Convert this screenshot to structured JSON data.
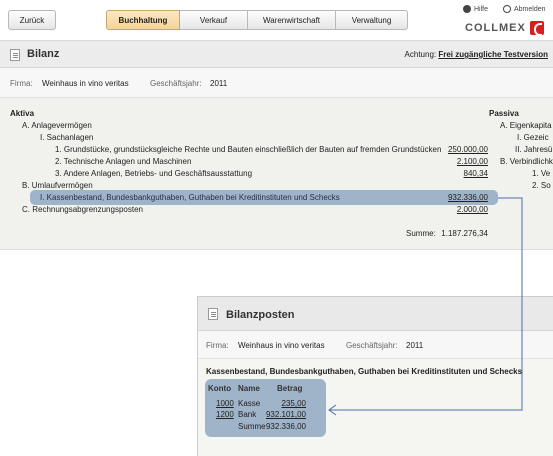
{
  "nav": {
    "back_label": "Zurück",
    "tabs": [
      {
        "label": "Buchhaltung",
        "active": true
      },
      {
        "label": "Verkauf",
        "active": false
      },
      {
        "label": "Warenwirtschaft",
        "active": false
      },
      {
        "label": "Verwaltung",
        "active": false
      }
    ],
    "help_label": "Hilfe",
    "logout_label": "Abmelden",
    "logo_text": "COLLMEX",
    "logo_color": "#d62020"
  },
  "page": {
    "title": "Bilanz",
    "warning_prefix": "Achtung:",
    "warning_link": "Frei zugängliche Testversion"
  },
  "firm": {
    "firm_label": "Firma:",
    "firm_value": "Weinhaus in vino veritas",
    "year_label": "Geschäftsjahr:",
    "year_value": "2011"
  },
  "balance": {
    "aktiva_heading": "Aktiva",
    "passiva_heading": "Passiva",
    "rows": {
      "a": "A.  Anlagevermögen",
      "a1": "I.  Sachanlagen",
      "a1_1": "1.  Grundstücke, grundstücksgleiche Rechte und Bauten einschließlich der Bauten auf fremden Grundstücken",
      "a1_2": "2.  Technische Anlagen und Maschinen",
      "a1_3": "3.  Andere Anlagen, Betriebs- und Geschäftsausstattung",
      "b": "B.  Umlaufvermögen",
      "b1": "I.  Kassenbestand, Bundesbankguthaben, Guthaben bei Kreditinstituten und Schecks",
      "c": "C.  Rechnungsabgrenzungsposten"
    },
    "amounts": {
      "a1_1": "250.000,00",
      "a1_2": "2.100,00",
      "a1_3": "840,34",
      "b1": "932.336,00",
      "c": "2.000,00"
    },
    "sum_label": "Summe:",
    "sum_value": "1.187.276,34",
    "passiva_rows": {
      "a": "A.  Eigenkapita",
      "a1": "I.  Gezeic",
      "a2": "II.  Jahresü",
      "b": "B.  Verbindlichk",
      "b1": "1.  Ve",
      "b2": "2.  So"
    }
  },
  "popup": {
    "title": "Bilanzposten",
    "firm_label": "Firma:",
    "firm_value": "Weinhaus in vino veritas",
    "year_label": "Geschäftsjahr:",
    "year_value": "2011",
    "subtitle": "Kassenbestand, Bundesbankguthaben, Guthaben bei Kreditinstituten und Schecks",
    "columns": [
      "Konto",
      "Name",
      "Betrag"
    ],
    "rows": [
      {
        "konto": "1000",
        "name": "Kasse",
        "betrag": "235,00"
      },
      {
        "konto": "1200",
        "name": "Bank",
        "betrag": "932.101,00"
      }
    ],
    "sum_label": "Summe",
    "sum_value": "932.336,00"
  }
}
